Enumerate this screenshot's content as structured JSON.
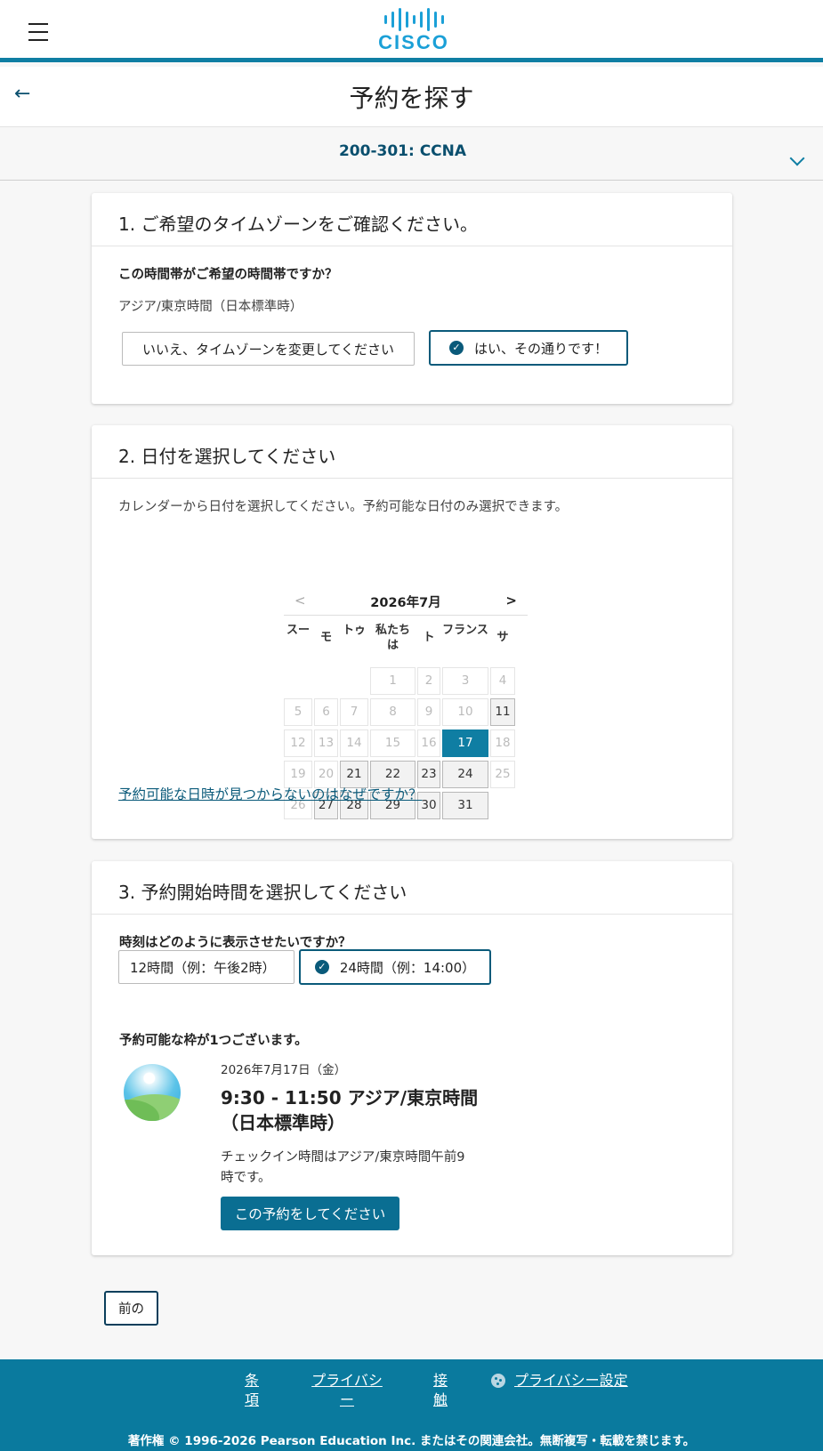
{
  "header": {
    "logo_text": "CISCO",
    "title": "予約を探す",
    "exam": "200-301: CCNA"
  },
  "colors": {
    "accent": "#0f7ea3",
    "brand": "#1ba0d7",
    "dark": "#0a5a7a"
  },
  "step1": {
    "heading": "1. ご希望のタイムゾーンをご確認ください。",
    "question": "この時間帯がご希望の時間帯ですか？",
    "timezone": "アジア/東京時間（日本標準時）",
    "no_button": "いいえ、タイムゾーンを変更してください",
    "yes_button": "はい、その通りです！"
  },
  "step2": {
    "heading": "2. 日付を選択してください",
    "instruction": "カレンダーから日付を選択してください。予約可能な日付のみ選択できます。",
    "calendar": {
      "prev": "<",
      "next": ">",
      "month": "2026年7月",
      "weekdays": [
        "スー",
        "モ",
        "トゥ",
        "私たちは",
        "ト",
        "フランス",
        "サ"
      ],
      "weeks": [
        [
          "",
          "",
          "",
          "1",
          "2",
          "3",
          "4"
        ],
        [
          "5",
          "6",
          "7",
          "8",
          "9",
          "10",
          "11"
        ],
        [
          "12",
          "13",
          "14",
          "15",
          "16",
          "17",
          "18"
        ],
        [
          "19",
          "20",
          "21",
          "22",
          "23",
          "24",
          "25"
        ],
        [
          "26",
          "27",
          "28",
          "29",
          "30",
          "31",
          ""
        ]
      ],
      "available": [
        "11",
        "21",
        "22",
        "23",
        "24",
        "27",
        "28",
        "29",
        "30",
        "31"
      ],
      "selected": "17"
    },
    "help_link": "予約可能な日時が見つからないのはなぜですか？"
  },
  "step3": {
    "heading": "3. 予約開始時間を選択してください",
    "question": "時刻はどのように表示させたいですか？",
    "format_12": "12時間（例：午後2時）",
    "format_24": "24時間（例：14:00）",
    "slots_count": "予約可能な枠が1つございます。",
    "slot_date": "2026年7月17日（金）",
    "slot_time_line1": "9:30 - 11:50 アジア/東京時間",
    "slot_time_line2": "（日本標準時）",
    "checkin_line1": "チェックイン時間はアジア/東京時間午前9",
    "checkin_line2": "時です。",
    "book_button": "この予約をしてください"
  },
  "nav": {
    "previous": "前の"
  },
  "footer": {
    "terms_1": "条",
    "terms_2": "項",
    "privacy_1": "プライバシ",
    "privacy_2": "ー",
    "contact_1": "接",
    "contact_2": "触",
    "privacy_settings": "プライバシー設定",
    "copyright": "著作権 © 1996-2026 Pearson Education Inc. またはその関連会社。無断複写・転載を禁じます。"
  }
}
